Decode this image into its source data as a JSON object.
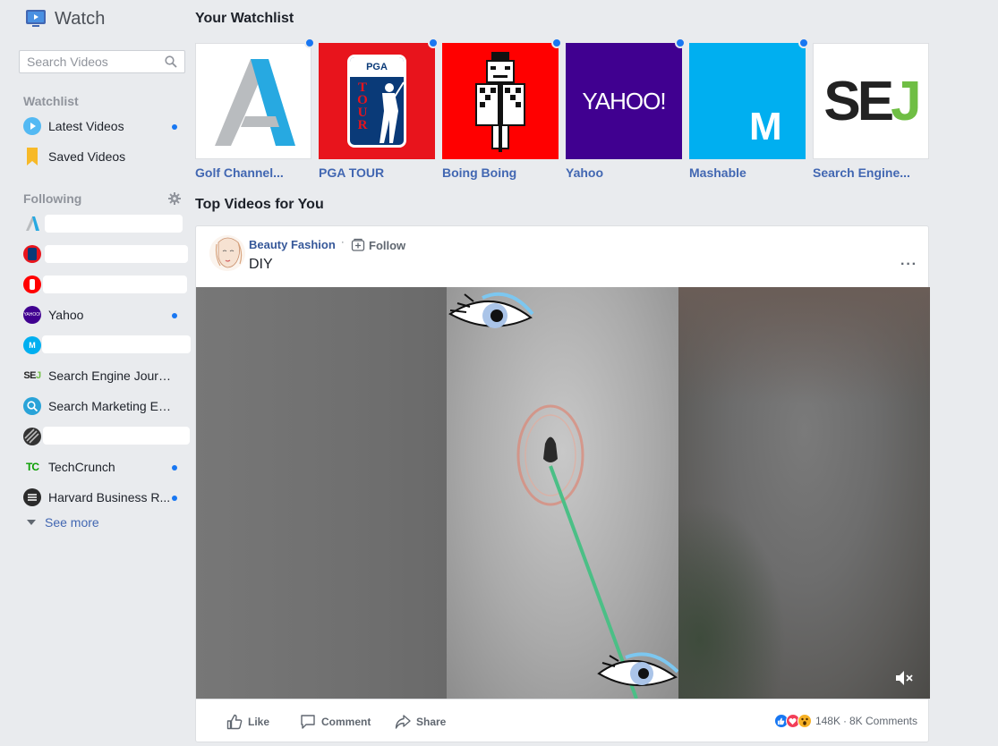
{
  "app": {
    "title": "Watch"
  },
  "search": {
    "placeholder": "Search Videos"
  },
  "sidebar": {
    "watchlist_heading": "Watchlist",
    "watchlist_items": [
      {
        "label": "Latest Videos",
        "icon": "play-circle-icon",
        "new": true
      },
      {
        "label": "Saved Videos",
        "icon": "bookmark-icon",
        "new": false
      }
    ],
    "following_heading": "Following",
    "following": [
      {
        "label": "",
        "icon": "golf-channel-logo",
        "new": false,
        "redacted": true
      },
      {
        "label": "",
        "icon": "pga-tour-logo",
        "new": false,
        "redacted": true
      },
      {
        "label": "",
        "icon": "boing-boing-logo",
        "new": false,
        "redacted": true
      },
      {
        "label": "Yahoo",
        "icon": "yahoo-logo",
        "new": true
      },
      {
        "label": "",
        "icon": "mashable-logo",
        "new": false,
        "redacted": true
      },
      {
        "label": "Search Engine Journal",
        "icon": "sej-logo",
        "new": false
      },
      {
        "label": "Search Marketing Expo",
        "icon": "sme-logo",
        "new": false
      },
      {
        "label": "",
        "icon": "dark-sphere-logo",
        "new": false,
        "redacted": true
      },
      {
        "label": "TechCrunch",
        "icon": "techcrunch-logo",
        "new": true
      },
      {
        "label": "Harvard Business R...",
        "icon": "hbr-logo",
        "new": true
      }
    ],
    "see_more": "See more"
  },
  "main": {
    "watchlist_heading": "Your Watchlist",
    "watchlist_cards": [
      {
        "name": "Golf Channel...",
        "logo": "golf-channel-logo",
        "new": true
      },
      {
        "name": "PGA TOUR",
        "logo": "pga-tour-logo",
        "new": true
      },
      {
        "name": "Boing Boing",
        "logo": "boing-boing-logo",
        "new": true
      },
      {
        "name": "Yahoo",
        "logo": "yahoo-logo",
        "new": true
      },
      {
        "name": "Mashable",
        "logo": "mashable-logo",
        "new": true
      },
      {
        "name": "Search Engine...",
        "logo": "sej-logo",
        "new": false
      }
    ],
    "logo_text": {
      "pga_top": "PGA",
      "pga_main": "TOUR",
      "yahoo": "YAHOO!",
      "mashable": "M",
      "sej_main": "SE",
      "sej_accent": "J"
    },
    "top_heading": "Top Videos for You",
    "post": {
      "page_name": "Beauty Fashion",
      "separator": "·",
      "follow_label": "Follow",
      "title": "DIY",
      "more": "···",
      "actions": {
        "like": "Like",
        "comment": "Comment",
        "share": "Share"
      },
      "reaction_count": "148K",
      "comments": "8K Comments"
    }
  },
  "colors": {
    "accent": "#1877f2",
    "link": "#4267b2",
    "golf_blue": "#27a9e1",
    "pga_red": "#e8141c",
    "boing_red": "#ff0000",
    "yahoo_purple": "#400090",
    "mashable_blue": "#00aff0",
    "sej_green": "#6fbe44"
  }
}
